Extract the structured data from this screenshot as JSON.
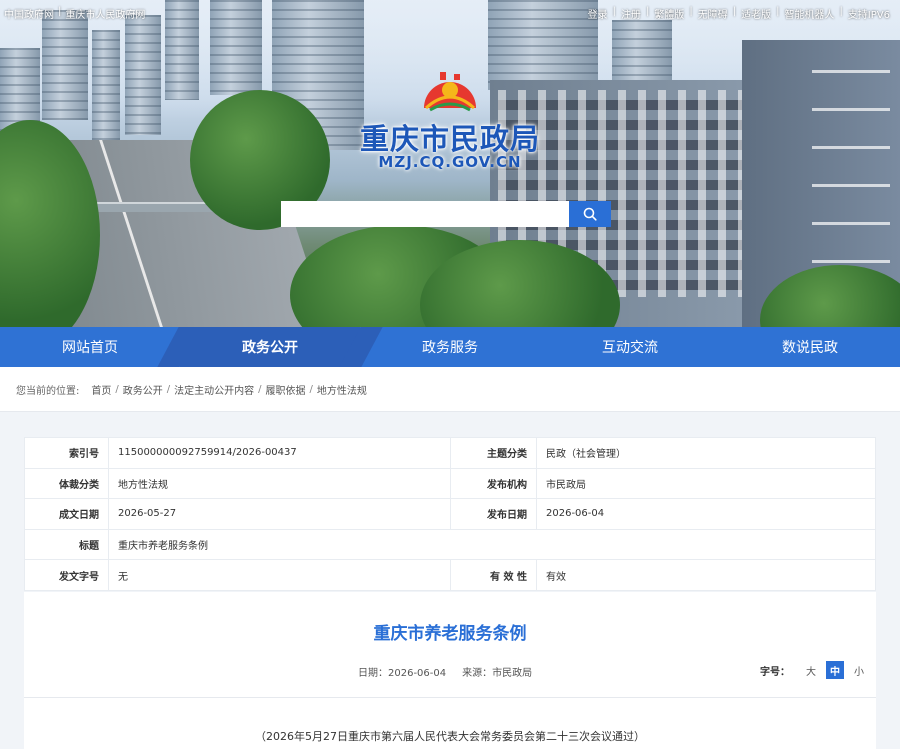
{
  "top_links_left": [
    "中国政府网",
    "重庆市人民政府网"
  ],
  "top_links_right": [
    "登录",
    "注册",
    "繁體版",
    "无障碍",
    "适老版",
    "智能机器人",
    "支持IPV6"
  ],
  "site": {
    "title": "重庆市民政局",
    "domain": "MZJ.CQ.GOV.CN"
  },
  "search": {
    "placeholder": ""
  },
  "nav": [
    {
      "label": "网站首页"
    },
    {
      "label": "政务公开",
      "active": true
    },
    {
      "label": "政务服务"
    },
    {
      "label": "互动交流"
    },
    {
      "label": "数说民政"
    }
  ],
  "breadcrumb": {
    "lead": "您当前的位置:",
    "items": [
      "首页",
      "政务公开",
      "法定主动公开内容",
      "履职依据",
      "地方性法规"
    ]
  },
  "info": {
    "index_label": "索引号",
    "index_value": "115000000092759914/2026-00437",
    "topic_label": "主题分类",
    "topic_value": "民政（社会管理）",
    "genre_label": "体裁分类",
    "genre_value": "地方性法规",
    "publisher_label": "发布机构",
    "publisher_value": "市民政局",
    "created_label": "成文日期",
    "created_value": "2026-05-27",
    "published_label": "发布日期",
    "published_value": "2026-06-04",
    "title_label": "标题",
    "title_value": "重庆市养老服务条例",
    "docno_label": "发文字号",
    "docno_value": "无",
    "validity_label": "有 效 性",
    "validity_value": "有效"
  },
  "article": {
    "title": "重庆市养老服务条例",
    "date": "日期：2026-06-04",
    "source": "来源：市民政局",
    "fontsize_label": "字号：",
    "fontsize_options": [
      "大",
      "中",
      "小"
    ],
    "fontsize_active": "中",
    "note": "（2026年5月27日重庆市第六届人民代表大会常务委员会第二十三次会议通过）"
  },
  "colors": {
    "primary": "#2f72d4",
    "nav_active": "#2c5fb8",
    "title_blue": "#2a6fd6"
  }
}
